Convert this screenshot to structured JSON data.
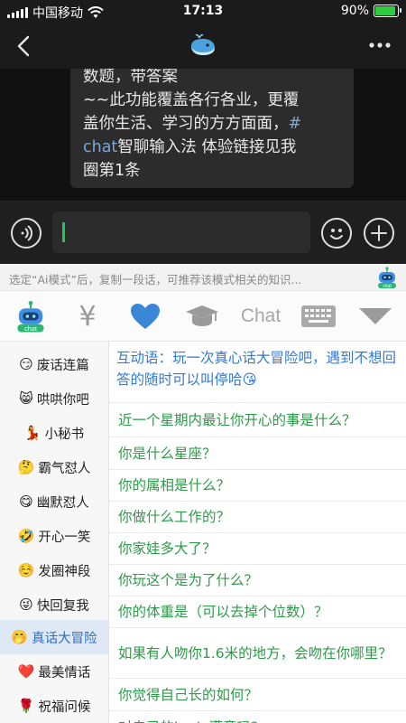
{
  "status": {
    "carrier": "中国移动",
    "time": "17:13",
    "battery": "90%",
    "battery_level": 0.9
  },
  "header": {
    "back_icon": "chevron-left-icon",
    "title_icon": "whale-icon",
    "more_icon": "more-dots-icon"
  },
  "chat": {
    "message_lines": [
      "数题，带答案",
      "~~此功能覆盖各行各业，更覆",
      "盖你生活、学习的方方面面，",
      "智聊输入法 体验链接见我",
      "圈第1条"
    ],
    "link_hash": "#",
    "link_chat": "chat"
  },
  "input": {
    "voice_icon": "voice-icon",
    "emoji_icon": "emoji-icon",
    "plus_icon": "plus-icon"
  },
  "hint": {
    "text": "选定“Ai模式”后，复制一段话，可推荐该模式相关的知识...",
    "logo_label": "chat"
  },
  "toolbar": {
    "yen": "¥",
    "chat_label": "Chat",
    "icons": [
      "robot-logo-icon",
      "yen-icon",
      "heart-icon",
      "graduation-cap-icon",
      "chat-tab",
      "keyboard-icon",
      "collapse-triangle-icon"
    ]
  },
  "categories": [
    {
      "emoji": "😏",
      "label": "废话连篇"
    },
    {
      "emoji": "😸",
      "label": "哄哄你吧"
    },
    {
      "emoji": "💃",
      "label": "小秘书"
    },
    {
      "emoji": "🤔",
      "label": "霸气怼人"
    },
    {
      "emoji": "😋",
      "label": "幽默怼人"
    },
    {
      "emoji": "🤣",
      "label": "开心一笑"
    },
    {
      "emoji": "☺️",
      "label": "发圈神段"
    },
    {
      "emoji": "😜",
      "label": "快回复我"
    },
    {
      "emoji": "🤭",
      "label": "真话大冒险"
    },
    {
      "emoji": "❤️",
      "label": "最美情话"
    },
    {
      "emoji": "🌹",
      "label": "祝福问候"
    }
  ],
  "content": {
    "header": "互动语：玩一次真心话大冒险吧，遇到不想回答的随时可以叫停哈😘",
    "rows": [
      "近一个星期内最让你开心的事是什么？",
      "你是什么星座？",
      "你的属相是什么？",
      "你做什么工作的？",
      "你家娃多大了？",
      "你玩这个是为了什么？",
      "你的体重是（可以去掉个位数）？",
      "如果有人吻你1.6米的地方，会吻在你哪里？",
      "你觉得自己长的如何？",
      "对自己的body满意吗？"
    ]
  },
  "colors": {
    "accent_blue": "#2e7bd6",
    "row_green": "#2e9a4a",
    "caret_green": "#22c65a",
    "heart_blue": "#3a87d8"
  }
}
